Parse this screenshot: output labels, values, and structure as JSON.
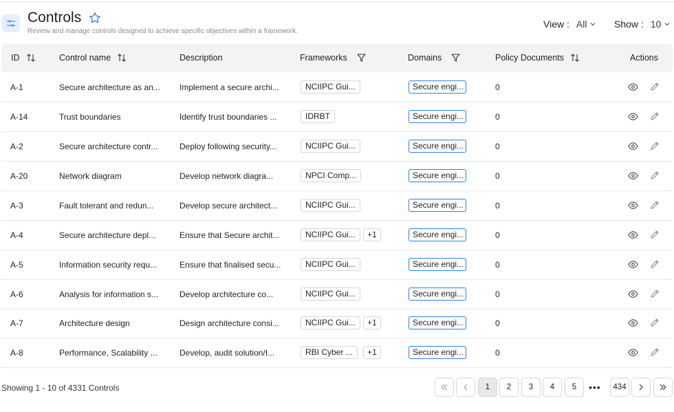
{
  "header": {
    "title": "Controls",
    "subtitle": "Review and manage controls designed to achieve specific objectives within a framework.",
    "view_label": "View :",
    "view_value": "All",
    "show_label": "Show :",
    "show_value": "10"
  },
  "table": {
    "columns": {
      "id": "ID",
      "name": "Control name",
      "description": "Description",
      "frameworks": "Frameworks",
      "domains": "Domains",
      "policy": "Policy Documents",
      "actions": "Actions"
    },
    "rows": [
      {
        "id": "A-1",
        "name": "Secure architecture as an...",
        "description": "Implement a secure archi...",
        "framework": "NCIIPC Gui...",
        "extra": "",
        "domain": "Secure engi...",
        "policy": "0"
      },
      {
        "id": "A-14",
        "name": "Trust boundaries",
        "description": "Identify trust boundaries ...",
        "framework": "IDRBT",
        "extra": "",
        "domain": "Secure engi...",
        "policy": "0"
      },
      {
        "id": "A-2",
        "name": "Secure architecture contr...",
        "description": "Deploy following security...",
        "framework": "NCIIPC Gui...",
        "extra": "",
        "domain": "Secure engi...",
        "policy": "0"
      },
      {
        "id": "A-20",
        "name": "Network diagram",
        "description": "Develop network diagra...",
        "framework": "NPCI Comp...",
        "extra": "",
        "domain": "Secure engi...",
        "policy": "0"
      },
      {
        "id": "A-3",
        "name": "Fault tolerant and redun...",
        "description": "Develop secure architect...",
        "framework": "NCIIPC Gui...",
        "extra": "",
        "domain": "Secure engi...",
        "policy": "0"
      },
      {
        "id": "A-4",
        "name": "Secure architecture depl...",
        "description": "Ensure that Secure archit...",
        "framework": "NCIIPC Gui...",
        "extra": "+1",
        "domain": "Secure engi...",
        "policy": "0"
      },
      {
        "id": "A-5",
        "name": "Information security requ...",
        "description": "Ensure that finalised secu...",
        "framework": "NCIIPC Gui...",
        "extra": "",
        "domain": "Secure engi...",
        "policy": "0"
      },
      {
        "id": "A-6",
        "name": "Analysis for information s...",
        "description": "Develop architecture co...",
        "framework": "NCIIPC Gui...",
        "extra": "",
        "domain": "Secure engi...",
        "policy": "0"
      },
      {
        "id": "A-7",
        "name": "Architecture design",
        "description": "Design architecture consi...",
        "framework": "NCIIPC Gui...",
        "extra": "+1",
        "domain": "Secure engi...",
        "policy": "0"
      },
      {
        "id": "A-8",
        "name": "Performance, Scalability ...",
        "description": "Develop, audit solution/I...",
        "framework": "RBI Cyber ...",
        "extra": "+1",
        "domain": "Secure engi...",
        "policy": "0"
      }
    ]
  },
  "footer": {
    "summary": "Showing 1 - 10 of 4331 Controls",
    "pages": [
      "1",
      "2",
      "3",
      "4",
      "5"
    ],
    "ellipsis": "•••",
    "last_page": "434"
  },
  "colors": {
    "accent": "#2f7fd6",
    "header_bg": "#f3f3f3",
    "icon_bg": "#e6eefc"
  }
}
